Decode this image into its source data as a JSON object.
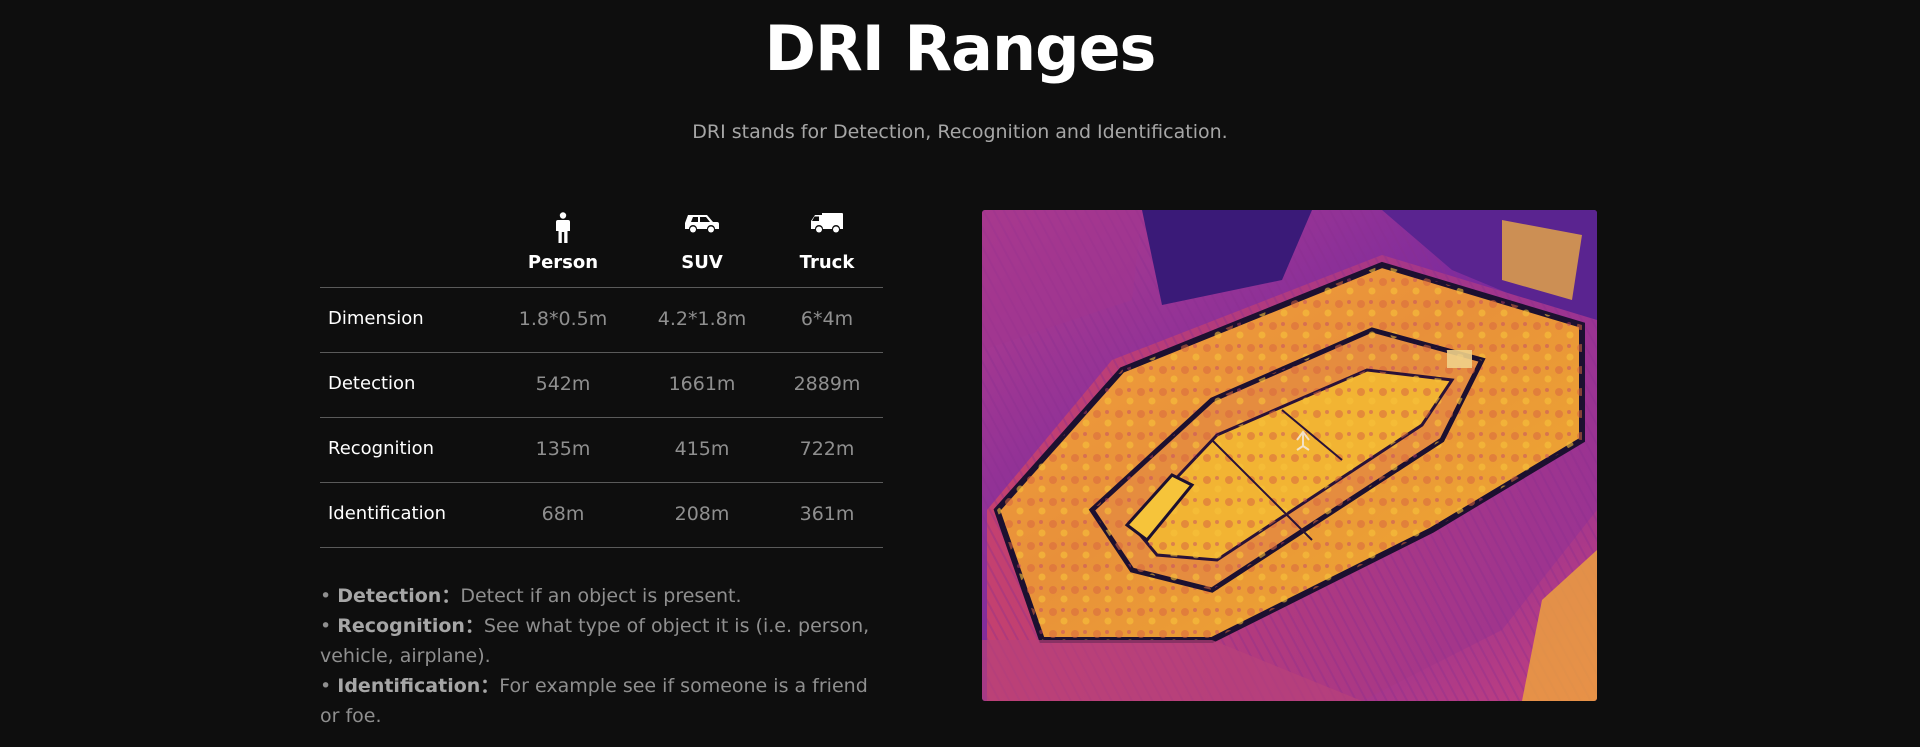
{
  "title": "DRI Ranges",
  "subtitle": "DRI stands for Detection, Recognition and Identification.",
  "table": {
    "columns": [
      {
        "label": "Person",
        "icon": "person-icon"
      },
      {
        "label": "SUV",
        "icon": "suv-icon"
      },
      {
        "label": "Truck",
        "icon": "truck-icon"
      }
    ],
    "rows": [
      {
        "label": "Dimension",
        "values": [
          "1.8*0.5m",
          "4.2*1.8m",
          "6*4m"
        ]
      },
      {
        "label": "Detection",
        "values": [
          "542m",
          "1661m",
          "2889m"
        ]
      },
      {
        "label": "Recognition",
        "values": [
          "135m",
          "415m",
          "722m"
        ]
      },
      {
        "label": "Identification",
        "values": [
          "68m",
          "208m",
          "361m"
        ]
      }
    ]
  },
  "notes": [
    {
      "bullet": "•",
      "term": "Detection：",
      "text": "Detect if an object is present."
    },
    {
      "bullet": "•",
      "term": "Recognition：",
      "text": "See what type of object it is (i.e. person, vehicle, airplane)."
    },
    {
      "bullet": "•",
      "term": "Identification：",
      "text": "For example see if someone is a friend or foe."
    }
  ],
  "colors": {
    "background": "#0e0e0e",
    "heading": "#ffffff",
    "muted": "#8f8f8f",
    "divider": "#5a5a5a",
    "thermal_hot": "#f5b324",
    "thermal_warm": "#d4387a",
    "thermal_cool": "#5a1f9a"
  }
}
